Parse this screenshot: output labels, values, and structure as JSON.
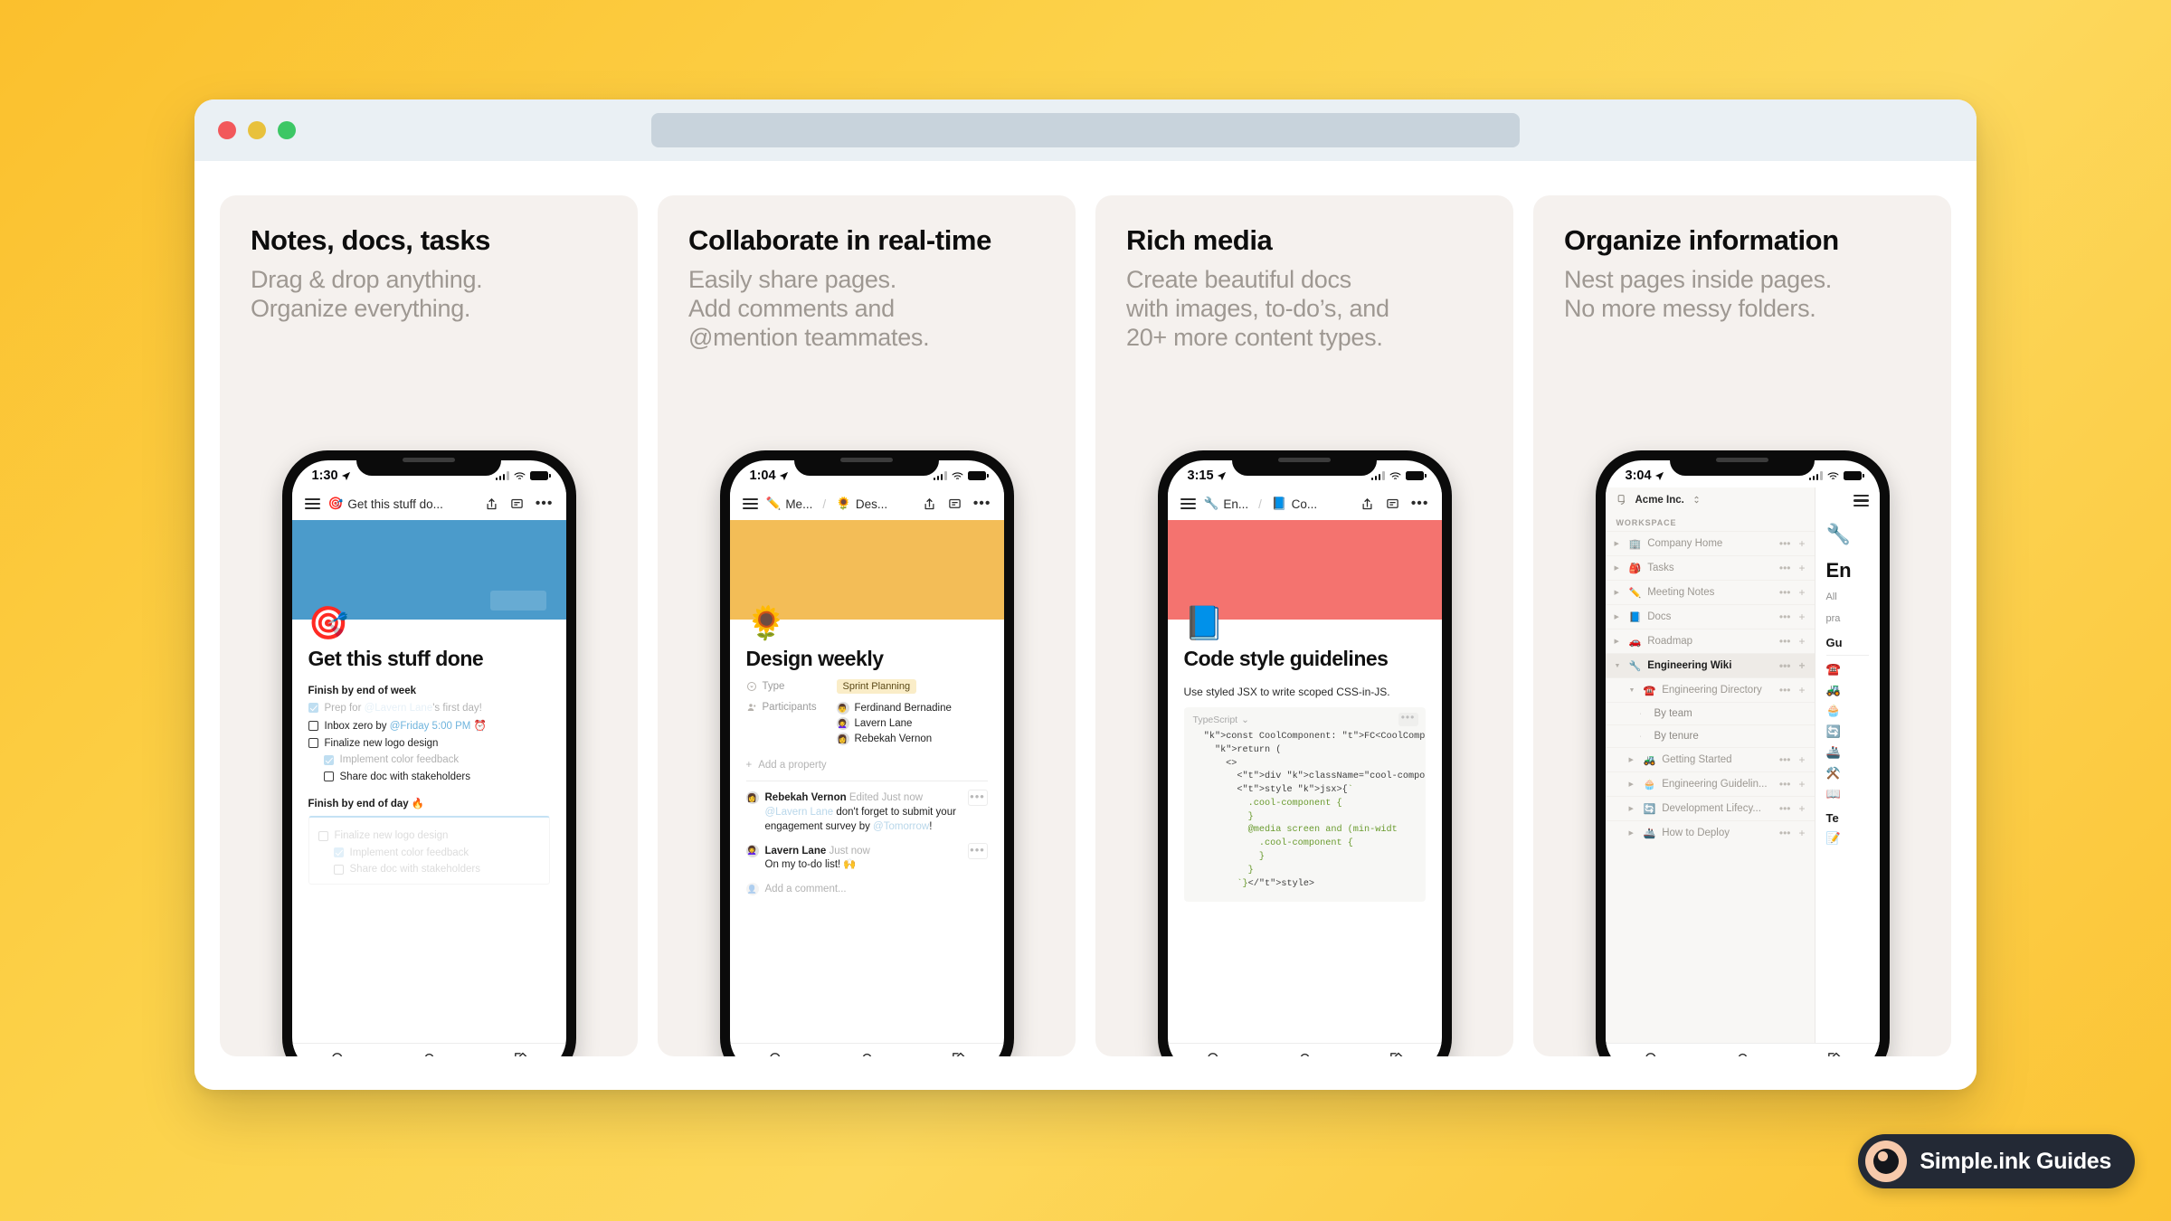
{
  "browser": {
    "traffic_lights": [
      "close",
      "minimize",
      "maximize"
    ],
    "url_value": "",
    "url_placeholder": ""
  },
  "cards": [
    {
      "title": "Notes, docs, tasks",
      "subtitle": "Drag & drop anything.\nOrganize everything.",
      "phone": {
        "time": "1:30",
        "nav_crumbs": [
          {
            "emoji": "🎯",
            "label": "Get this stuff do..."
          }
        ],
        "cover_color": "#4b9bcb",
        "cover_emoji": "🎯",
        "doc_title": "Get this stuff done",
        "sections": [
          {
            "heading": "Finish by end of week",
            "items": [
              {
                "checked": true,
                "indent": 0,
                "pre": "Prep for ",
                "mention": "@Lavern Lane",
                "post": "'s first day!",
                "dim": true
              },
              {
                "checked": false,
                "indent": 0,
                "pre": "Inbox zero by ",
                "mention": "@Friday 5:00 PM",
                "post": " ⏰",
                "dim": false
              },
              {
                "checked": false,
                "indent": 0,
                "pre": "Finalize new logo design",
                "mention": "",
                "post": "",
                "dim": false
              },
              {
                "checked": true,
                "indent": 1,
                "pre": "Implement color feedback",
                "mention": "",
                "post": "",
                "dim": true
              },
              {
                "checked": false,
                "indent": 1,
                "pre": "Share doc with stakeholders",
                "mention": "",
                "post": "",
                "dim": false
              }
            ]
          },
          {
            "heading": "Finish by end of day 🔥",
            "ghost": true,
            "items": [
              {
                "checked": false,
                "indent": 0,
                "pre": "Finalize new logo design",
                "mention": "",
                "post": "",
                "dim": true
              },
              {
                "checked": true,
                "indent": 1,
                "pre": "Implement color feedback",
                "mention": "",
                "post": "",
                "dim": true
              },
              {
                "checked": false,
                "indent": 1,
                "pre": "Share doc with stakeholders",
                "mention": "",
                "post": "",
                "dim": true
              }
            ]
          }
        ]
      }
    },
    {
      "title": "Collaborate in real-time",
      "subtitle": "Easily share pages.\nAdd comments and\n@mention teammates.",
      "phone": {
        "time": "1:04",
        "nav_crumbs": [
          {
            "emoji": "✏️",
            "label": "Me..."
          },
          {
            "emoji": "🌻",
            "label": "Des..."
          }
        ],
        "cover_color": "#f3bd57",
        "cover_emoji": "🌻",
        "doc_title": "Design weekly",
        "properties": [
          {
            "key": "Type",
            "key_icon": "select-icon",
            "chip": "Sprint Planning"
          },
          {
            "key": "Participants",
            "key_icon": "person-icon",
            "people": [
              {
                "name": "Ferdinand Bernadine",
                "avatar": "👨"
              },
              {
                "name": "Lavern Lane",
                "avatar": "👩‍🦱"
              },
              {
                "name": "Rebekah Vernon",
                "avatar": "👩"
              }
            ]
          }
        ],
        "add_property": "Add a property",
        "comments": [
          {
            "author": "Rebekah Vernon",
            "meta": "Edited Just now",
            "avatar": "👩",
            "mention": "@Lavern Lane",
            "text": " don't forget to submit your engagement survey by ",
            "mention2": "@Tomorrow",
            "tail": "!"
          },
          {
            "author": "Lavern Lane",
            "meta": "Just now",
            "avatar": "👩‍🦱",
            "mention": "",
            "text": "On my to-do list! 🙌",
            "mention2": "",
            "tail": ""
          }
        ],
        "comment_placeholder": "Add a comment..."
      }
    },
    {
      "title": "Rich media",
      "subtitle": "Create beautiful docs\nwith images, to-do’s, and\n20+ more content types.",
      "phone": {
        "time": "3:15",
        "nav_crumbs": [
          {
            "emoji": "🔧",
            "label": "En..."
          },
          {
            "emoji": "📘",
            "label": "Co..."
          }
        ],
        "cover_color": "#f4736f",
        "cover_emoji": "📘",
        "doc_title": "Code style guidelines",
        "intro": "Use styled JSX to write scoped CSS-in-JS.",
        "code_lang": "TypeScript",
        "code_lines": [
          "  const CoolComponent: FC<CoolCompone",
          "    return (",
          "      <>",
          "        <div className=\"cool-componen",
          "        <style jsx>{`",
          "          .cool-component {",
          "          }",
          "          @media screen and (min-widt",
          "            .cool-component {",
          "            }",
          "          }",
          "        `}</style>"
        ]
      }
    },
    {
      "title": "Organize information",
      "subtitle": "Nest pages inside pages.\nNo more messy folders.",
      "phone": {
        "time": "3:04",
        "workspace_name": "Acme Inc.",
        "section_label": "WORKSPACE",
        "sidebar_items": [
          {
            "emoji": "🏢",
            "label": "Company Home",
            "level": 0,
            "arrow": "right",
            "active": false
          },
          {
            "emoji": "🎒",
            "label": "Tasks",
            "level": 0,
            "arrow": "right",
            "active": false
          },
          {
            "emoji": "✏️",
            "label": "Meeting Notes",
            "level": 0,
            "arrow": "right",
            "active": false
          },
          {
            "emoji": "📘",
            "label": "Docs",
            "level": 0,
            "arrow": "right",
            "active": false
          },
          {
            "emoji": "🚗",
            "label": "Roadmap",
            "level": 0,
            "arrow": "right",
            "active": false
          },
          {
            "emoji": "🔧",
            "label": "Engineering Wiki",
            "level": 0,
            "arrow": "down",
            "active": true
          },
          {
            "emoji": "☎️",
            "label": "Engineering Directory",
            "level": 1,
            "arrow": "down",
            "active": false
          },
          {
            "emoji": "",
            "label": "By team",
            "level": 2,
            "arrow": "dot",
            "active": false
          },
          {
            "emoji": "",
            "label": "By tenure",
            "level": 2,
            "arrow": "dot",
            "active": false
          },
          {
            "emoji": "🚜",
            "label": "Getting Started",
            "level": 1,
            "arrow": "right",
            "active": false
          },
          {
            "emoji": "🧁",
            "label": "Engineering Guidelin...",
            "level": 1,
            "arrow": "right",
            "active": false
          },
          {
            "emoji": "🔄",
            "label": "Development Lifecy...",
            "level": 1,
            "arrow": "right",
            "active": false
          },
          {
            "emoji": "🚢",
            "label": "How to Deploy",
            "level": 1,
            "arrow": "right",
            "active": false
          }
        ],
        "page_emoji": "🔧",
        "page_title_fragment": "En",
        "page_sub_lines": [
          "All",
          "pra"
        ],
        "page_heading_fragment": "Gu",
        "page_icons": [
          "☎️",
          "🚜",
          "🧁",
          "🔄",
          "🚢",
          "⚒️",
          "📖"
        ],
        "page_heading2_fragment": "Te",
        "page_icon2": "📝"
      }
    }
  ],
  "bottom_nav": {
    "search": "search-icon",
    "notifications": "bell-icon",
    "compose": "compose-icon"
  },
  "badge": {
    "label": "Simple.ink Guides",
    "background": "#232935",
    "logo_ring": "#f7c9ab"
  }
}
